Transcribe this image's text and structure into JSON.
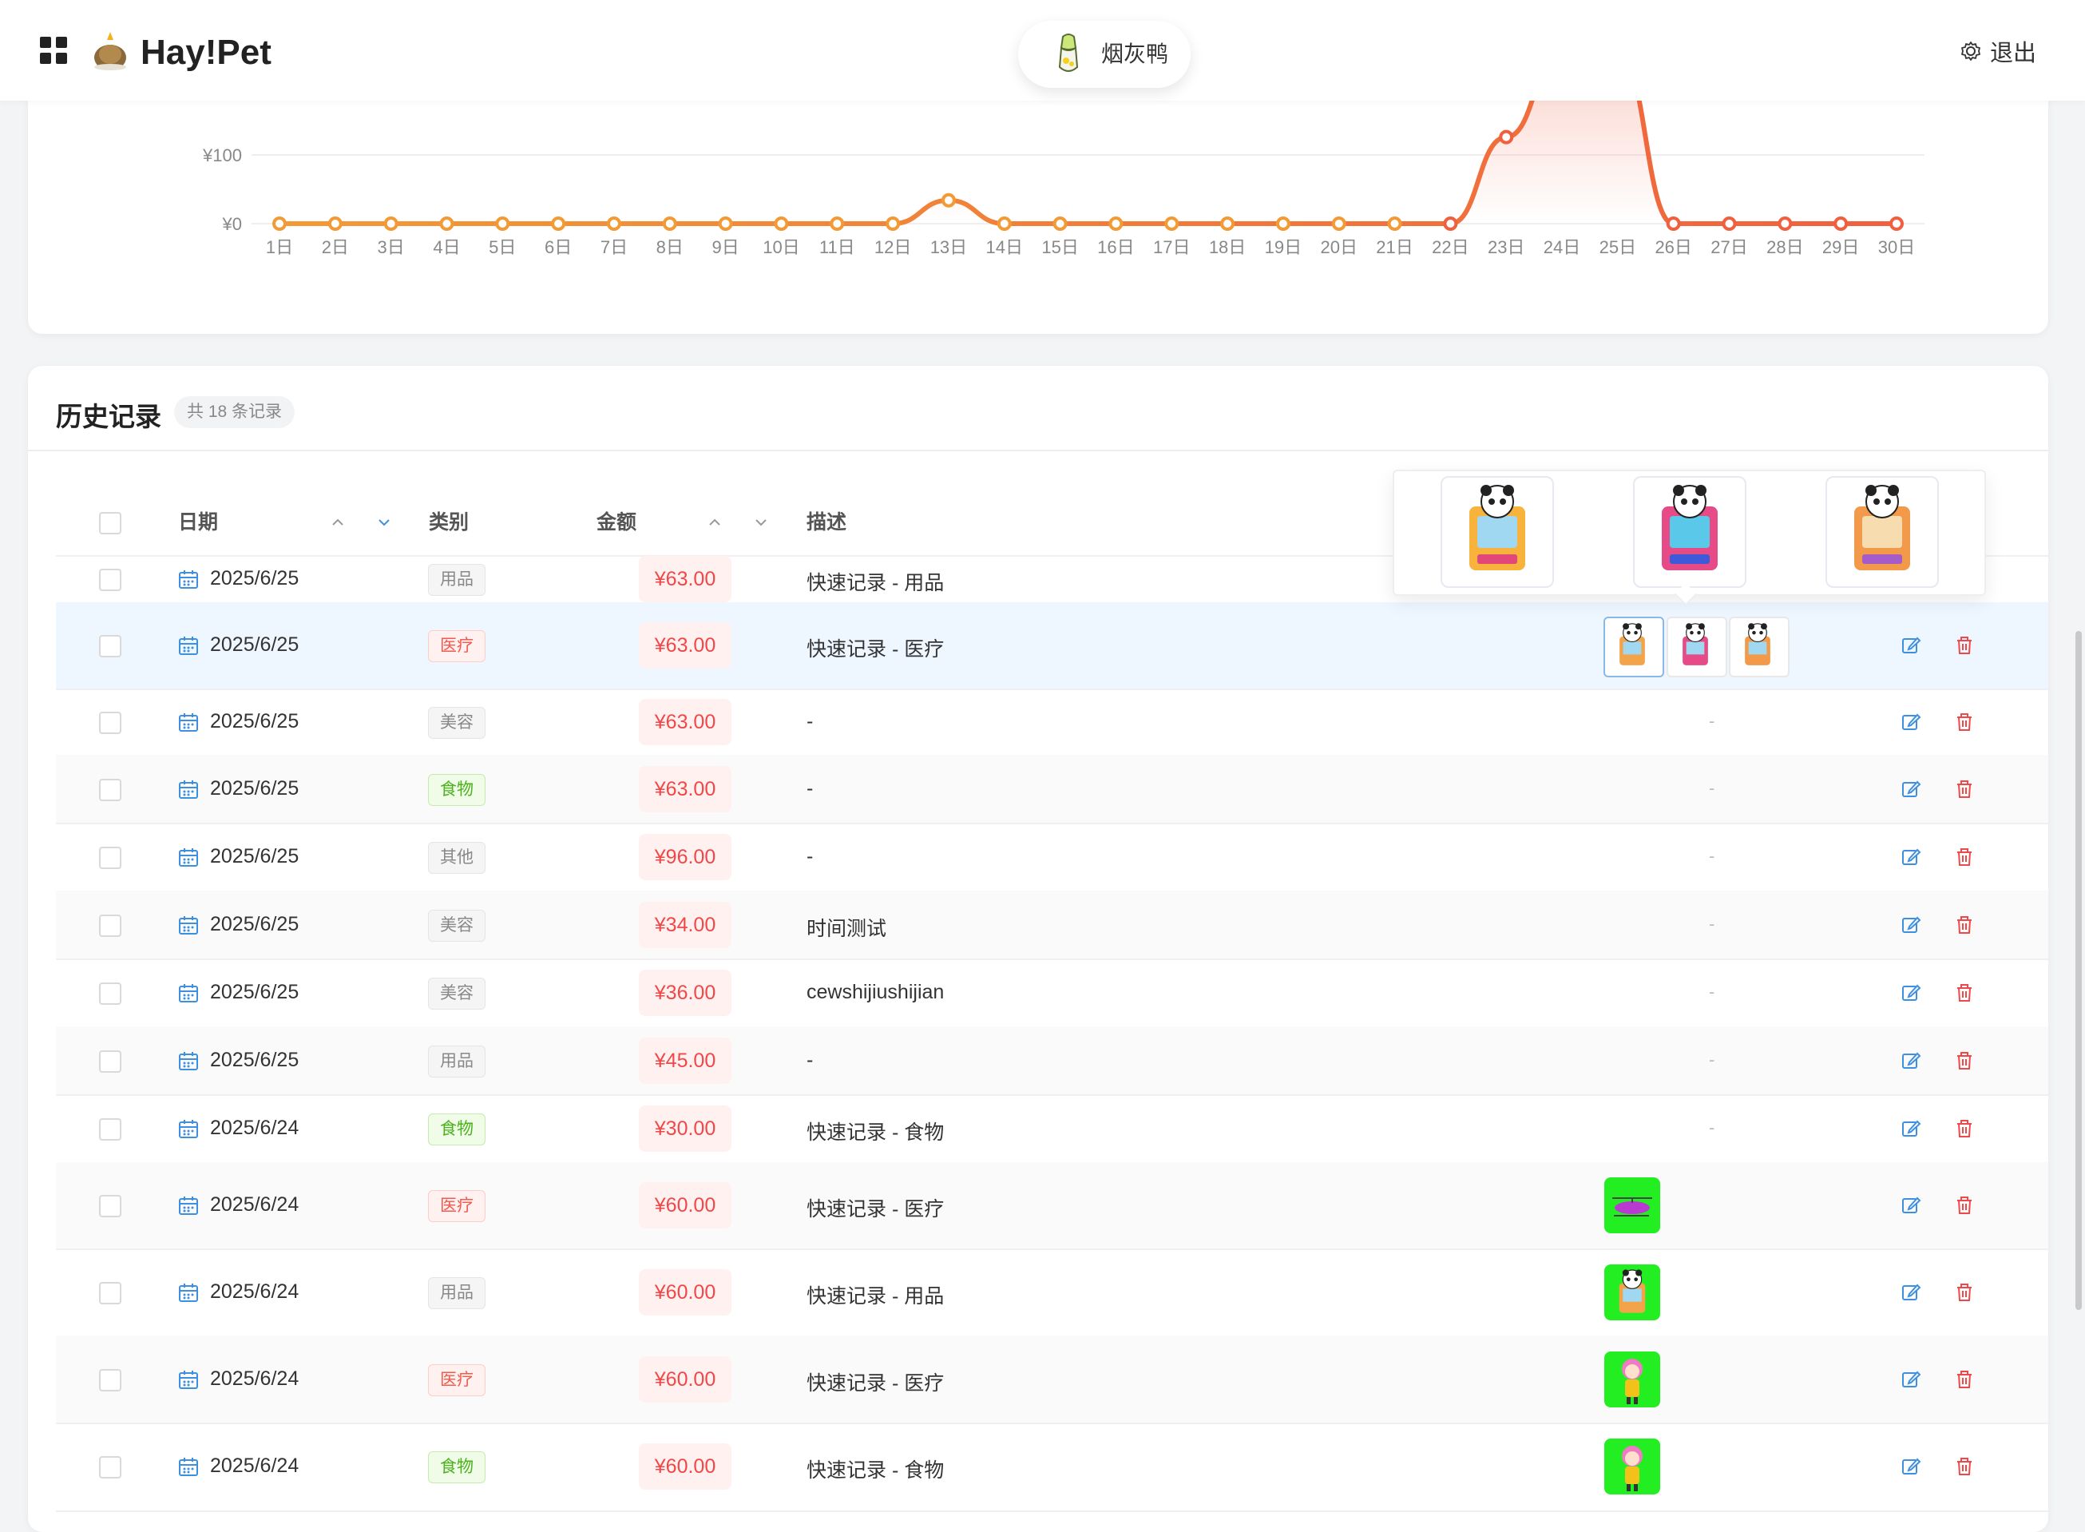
{
  "app": {
    "brand": "Hay!Pet"
  },
  "header": {
    "pet_name": "烟灰鸭",
    "logout_label": "退出"
  },
  "chart_data": {
    "type": "line",
    "x": [
      "1日",
      "2日",
      "3日",
      "4日",
      "5日",
      "6日",
      "7日",
      "8日",
      "9日",
      "10日",
      "11日",
      "12日",
      "13日",
      "14日",
      "15日",
      "16日",
      "17日",
      "18日",
      "19日",
      "20日",
      "21日",
      "22日",
      "23日",
      "24日",
      "25日",
      "26日",
      "27日",
      "28日",
      "29日",
      "30日"
    ],
    "values": [
      0,
      0,
      0,
      0,
      0,
      0,
      0,
      0,
      0,
      0,
      0,
      0,
      34,
      0,
      0,
      0,
      0,
      0,
      0,
      0,
      0,
      0,
      126,
      250,
      250,
      0,
      0,
      0,
      0,
      0
    ],
    "y_tick_labels": [
      "¥0",
      "¥100"
    ],
    "ylim": [
      0,
      100
    ],
    "color_start": "#f29a35",
    "color_end": "#f0603e",
    "grid": true
  },
  "history": {
    "title": "历史记录",
    "count_label": "共 18 条记录",
    "columns": {
      "date": "日期",
      "category": "类别",
      "amount": "金额",
      "description": "描述"
    },
    "rows": [
      {
        "date": "2025/6/25",
        "category": "用品",
        "cat_type": "plain",
        "amount": "¥63.00",
        "description": "快速记录 - 用品",
        "images": "popover-trigger"
      },
      {
        "date": "2025/6/25",
        "category": "医疗",
        "cat_type": "med",
        "amount": "¥63.00",
        "description": "快速记录 - 医疗",
        "images": "triple"
      },
      {
        "date": "2025/6/25",
        "category": "美容",
        "cat_type": "plain",
        "amount": "¥63.00",
        "description": "-",
        "images": "-"
      },
      {
        "date": "2025/6/25",
        "category": "食物",
        "cat_type": "food",
        "amount": "¥63.00",
        "description": "-",
        "images": "-"
      },
      {
        "date": "2025/6/25",
        "category": "其他",
        "cat_type": "plain",
        "amount": "¥96.00",
        "description": "-",
        "images": "-"
      },
      {
        "date": "2025/6/25",
        "category": "美容",
        "cat_type": "plain",
        "amount": "¥34.00",
        "description": "时间测试",
        "images": "-"
      },
      {
        "date": "2025/6/25",
        "category": "美容",
        "cat_type": "plain",
        "amount": "¥36.00",
        "description": "cewshijiushijian",
        "images": "-"
      },
      {
        "date": "2025/6/25",
        "category": "用品",
        "cat_type": "plain",
        "amount": "¥45.00",
        "description": "-",
        "images": "-"
      },
      {
        "date": "2025/6/24",
        "category": "食物",
        "cat_type": "food",
        "amount": "¥30.00",
        "description": "快速记录 - 食物",
        "images": "-"
      },
      {
        "date": "2025/6/24",
        "category": "医疗",
        "cat_type": "med",
        "amount": "¥60.00",
        "description": "快速记录 - 医疗",
        "images": "helicopter"
      },
      {
        "date": "2025/6/24",
        "category": "用品",
        "cat_type": "plain",
        "amount": "¥60.00",
        "description": "快速记录 - 用品",
        "images": "panda"
      },
      {
        "date": "2025/6/24",
        "category": "医疗",
        "cat_type": "med",
        "amount": "¥60.00",
        "description": "快速记录 - 医疗",
        "images": "girl"
      },
      {
        "date": "2025/6/24",
        "category": "食物",
        "cat_type": "food",
        "amount": "¥60.00",
        "description": "快速记录 - 食物",
        "images": "girl"
      }
    ]
  },
  "colors": {
    "accent_blue": "#3d8fe0",
    "danger_red": "#f04848"
  }
}
